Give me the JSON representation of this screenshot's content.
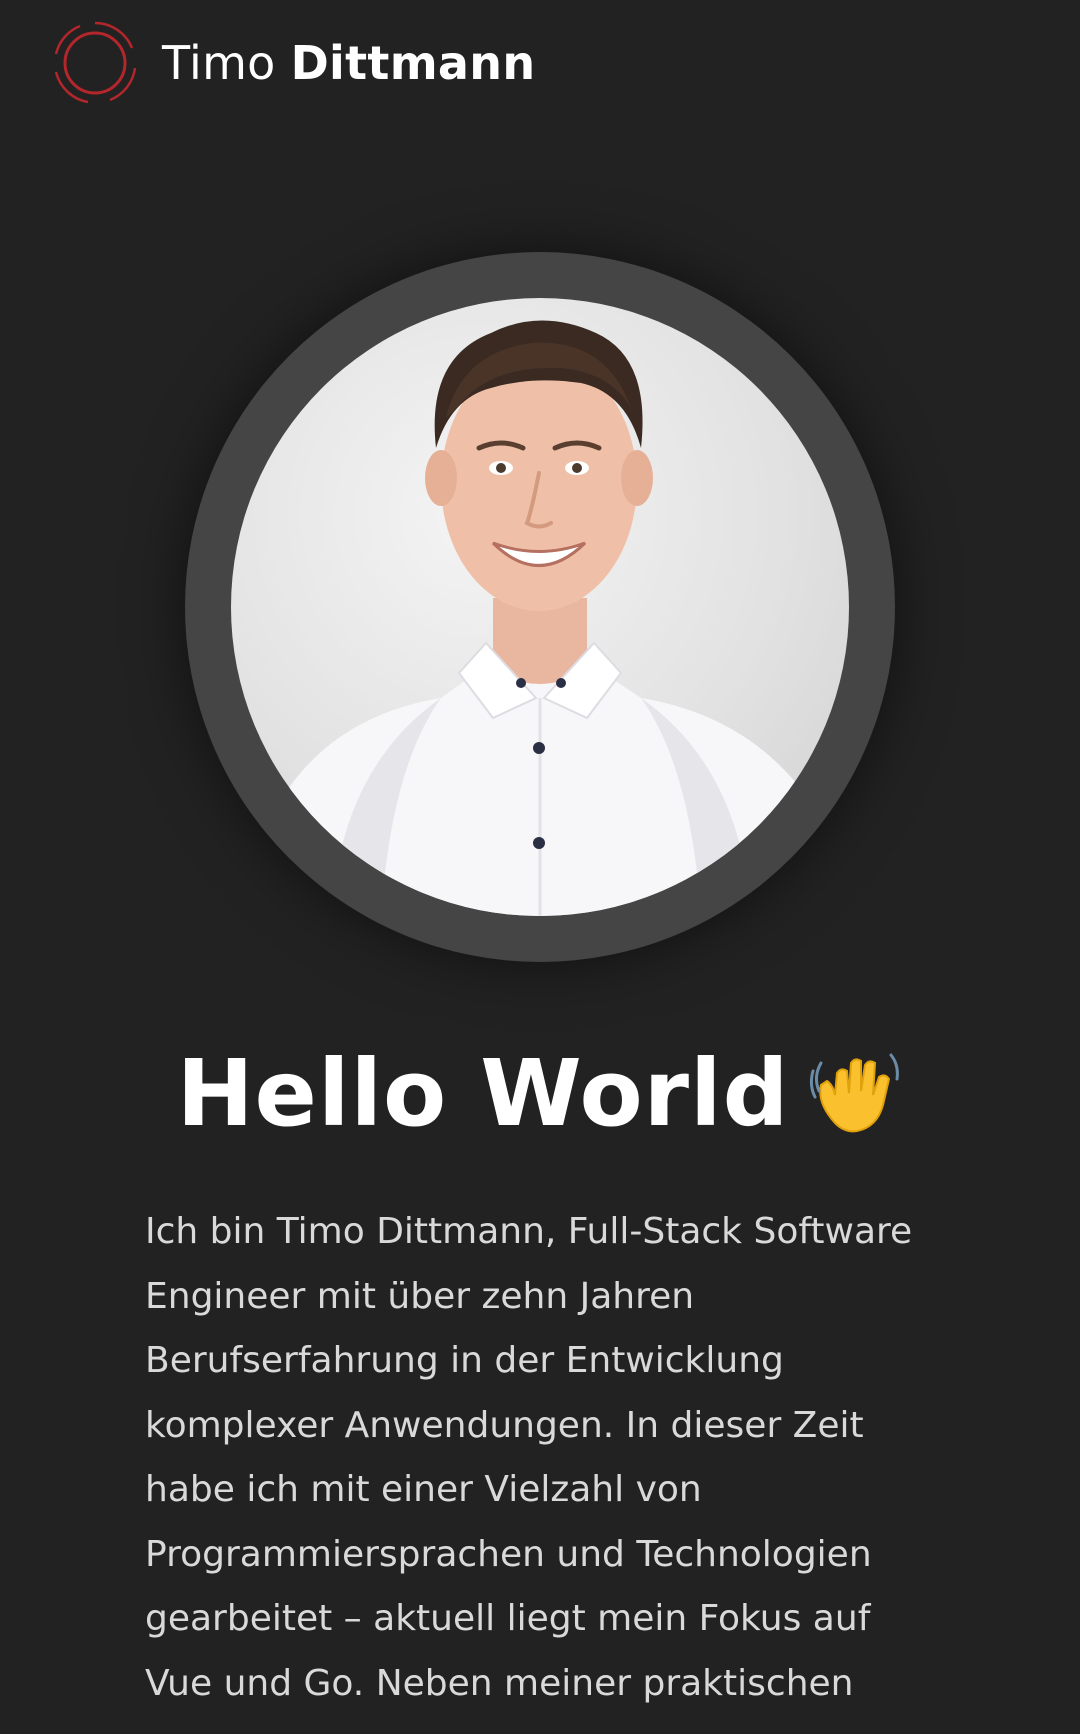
{
  "header": {
    "first_name": "Timo",
    "last_name": "Dittmann",
    "logo_icon": "ring-logo-icon",
    "accent_color": "#b3262b"
  },
  "hero": {
    "avatar_alt": "portrait-photo",
    "title": "Hello World",
    "title_icon": "waving-hand-icon",
    "bio_lines": [
      "Ich bin Timo Dittmann, Full-Stack Software",
      "Engineer mit über zehn Jahren",
      "Berufserfahrung in der Entwicklung",
      "komplexer Anwendungen. In dieser Zeit",
      "habe ich mit einer Vielzahl von",
      "Programmiersprachen und Technologien",
      "gearbeitet – aktuell liegt mein Fokus auf",
      "Vue und Go. Neben meiner praktischen"
    ]
  }
}
